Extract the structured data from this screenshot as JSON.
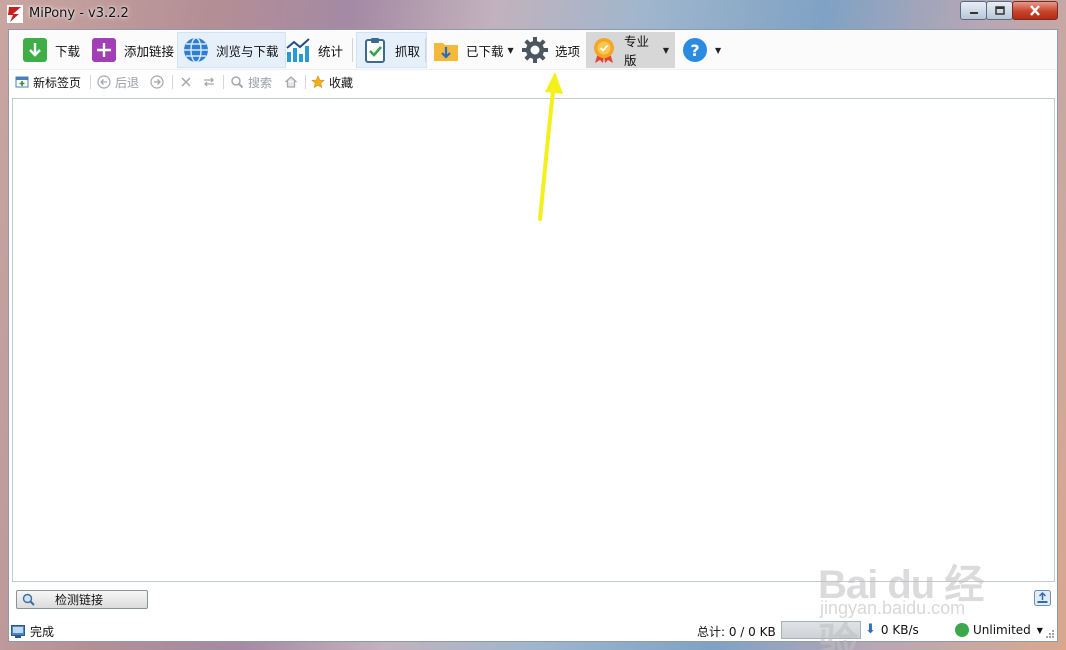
{
  "window": {
    "title": "MiPony - v3.2.2"
  },
  "toolbar": {
    "download": "下载",
    "add_link": "添加链接",
    "browse_download": "浏览与下载",
    "stats": "统计",
    "grab": "抓取",
    "downloaded": "已下载",
    "options": "选项",
    "pro": "专业版"
  },
  "navbar": {
    "new_tab": "新标签页",
    "back": "后退",
    "search": "搜索",
    "favorites": "收藏"
  },
  "check_links": "检测链接",
  "status": {
    "state": "完成",
    "total": "总计: 0 / 0 KB",
    "progress": 0,
    "speed": "0 KB/s",
    "limit": "Unlimited"
  },
  "watermark": {
    "brand": "Bai du 经验",
    "url": "jingyan.baidu.com"
  },
  "colors": {
    "annotation_arrow": "#f4f01c",
    "active_tab_bg": "#e5f0fb"
  }
}
